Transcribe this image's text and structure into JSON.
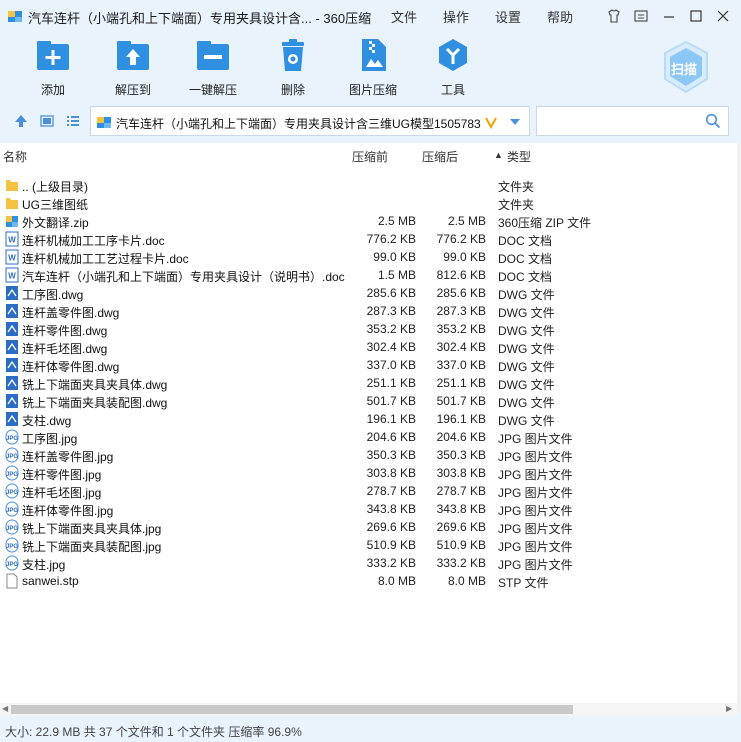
{
  "window": {
    "title": "汽车连杆（小端孔和上下端面）专用夹具设计含... - 360压缩",
    "menus": [
      "文件",
      "操作",
      "设置",
      "帮助"
    ]
  },
  "toolbar": {
    "add": "添加",
    "extract": "解压到",
    "one_click": "一键解压",
    "delete": "删除",
    "img_compress": "图片压缩",
    "tools": "工具",
    "scan": "扫描"
  },
  "address": {
    "path": "汽车连杆（小端孔和上下端面）专用夹具设计含三维UG模型1505783"
  },
  "columns": {
    "name": "名称",
    "before": "压缩前",
    "after": "压缩后",
    "type": "类型"
  },
  "files": [
    {
      "name": ".. (上级目录)",
      "before": "",
      "after": "",
      "type": "文件夹",
      "icon": "folder"
    },
    {
      "name": "UG三维图纸",
      "before": "",
      "after": "",
      "type": "文件夹",
      "icon": "folder"
    },
    {
      "name": "外文翻译.zip",
      "before": "2.5 MB",
      "after": "2.5 MB",
      "type": "360压缩 ZIP 文件",
      "icon": "zip"
    },
    {
      "name": "连杆机械加工工序卡片.doc",
      "before": "776.2 KB",
      "after": "776.2 KB",
      "type": "DOC 文档",
      "icon": "doc"
    },
    {
      "name": "连杆机械加工工艺过程卡片.doc",
      "before": "99.0 KB",
      "after": "99.0 KB",
      "type": "DOC 文档",
      "icon": "doc"
    },
    {
      "name": "汽车连杆（小端孔和上下端面）专用夹具设计（说明书）.doc",
      "before": "1.5 MB",
      "after": "812.6 KB",
      "type": "DOC 文档",
      "icon": "doc"
    },
    {
      "name": "工序图.dwg",
      "before": "285.6 KB",
      "after": "285.6 KB",
      "type": "DWG 文件",
      "icon": "dwg"
    },
    {
      "name": "连杆盖零件图.dwg",
      "before": "287.3 KB",
      "after": "287.3 KB",
      "type": "DWG 文件",
      "icon": "dwg"
    },
    {
      "name": "连杆零件图.dwg",
      "before": "353.2 KB",
      "after": "353.2 KB",
      "type": "DWG 文件",
      "icon": "dwg"
    },
    {
      "name": "连杆毛坯图.dwg",
      "before": "302.4 KB",
      "after": "302.4 KB",
      "type": "DWG 文件",
      "icon": "dwg"
    },
    {
      "name": "连杆体零件图.dwg",
      "before": "337.0 KB",
      "after": "337.0 KB",
      "type": "DWG 文件",
      "icon": "dwg"
    },
    {
      "name": "铣上下端面夹具夹具体.dwg",
      "before": "251.1 KB",
      "after": "251.1 KB",
      "type": "DWG 文件",
      "icon": "dwg"
    },
    {
      "name": "铣上下端面夹具装配图.dwg",
      "before": "501.7 KB",
      "after": "501.7 KB",
      "type": "DWG 文件",
      "icon": "dwg"
    },
    {
      "name": "支柱.dwg",
      "before": "196.1 KB",
      "after": "196.1 KB",
      "type": "DWG 文件",
      "icon": "dwg"
    },
    {
      "name": "工序图.jpg",
      "before": "204.6 KB",
      "after": "204.6 KB",
      "type": "JPG 图片文件",
      "icon": "jpg"
    },
    {
      "name": "连杆盖零件图.jpg",
      "before": "350.3 KB",
      "after": "350.3 KB",
      "type": "JPG 图片文件",
      "icon": "jpg"
    },
    {
      "name": "连杆零件图.jpg",
      "before": "303.8 KB",
      "after": "303.8 KB",
      "type": "JPG 图片文件",
      "icon": "jpg"
    },
    {
      "name": "连杆毛坯图.jpg",
      "before": "278.7 KB",
      "after": "278.7 KB",
      "type": "JPG 图片文件",
      "icon": "jpg"
    },
    {
      "name": "连杆体零件图.jpg",
      "before": "343.8 KB",
      "after": "343.8 KB",
      "type": "JPG 图片文件",
      "icon": "jpg"
    },
    {
      "name": "铣上下端面夹具夹具体.jpg",
      "before": "269.6 KB",
      "after": "269.6 KB",
      "type": "JPG 图片文件",
      "icon": "jpg"
    },
    {
      "name": "铣上下端面夹具装配图.jpg",
      "before": "510.9 KB",
      "after": "510.9 KB",
      "type": "JPG 图片文件",
      "icon": "jpg"
    },
    {
      "name": "支柱.jpg",
      "before": "333.2 KB",
      "after": "333.2 KB",
      "type": "JPG 图片文件",
      "icon": "jpg"
    },
    {
      "name": "sanwei.stp",
      "before": "8.0 MB",
      "after": "8.0 MB",
      "type": "STP 文件",
      "icon": "file"
    }
  ],
  "status": {
    "text": "大小: 22.9 MB 共 37 个文件和 1 个文件夹 压缩率 96.9%"
  },
  "colors": {
    "accent": "#2f8fe0",
    "folder": "#f5c342",
    "dwg": "#2b6cc4",
    "chrome_bg": "#e9f3fc"
  }
}
